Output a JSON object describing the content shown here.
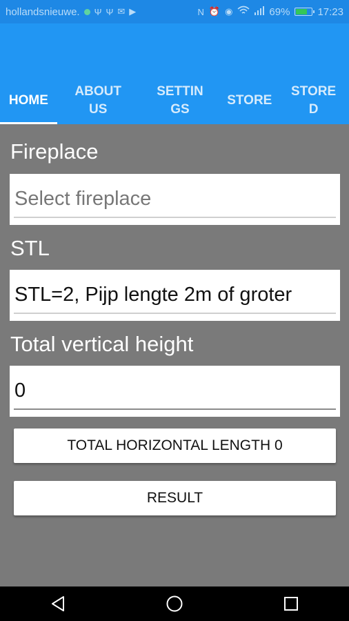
{
  "status_bar": {
    "notification_text": "hollandsnieuwe.",
    "battery_percent": "69%",
    "battery_level": 0.69,
    "time": "17:23",
    "icons": [
      "whatsapp-dot-icon",
      "usb-icon",
      "usb-icon",
      "mail-icon",
      "play-store-icon",
      "nfc-icon",
      "alarm-icon",
      "eye-icon",
      "wifi-icon",
      "signal-icon",
      "battery-icon"
    ]
  },
  "tabs": [
    {
      "label": "HOME",
      "active": true
    },
    {
      "label": "ABOUTUS",
      "active": false
    },
    {
      "label": "SETTINGS",
      "active": false
    },
    {
      "label": "STORE",
      "active": false
    },
    {
      "label": "STORED",
      "active": false
    }
  ],
  "form": {
    "fireplace_label": "Fireplace",
    "fireplace_placeholder": "Select fireplace",
    "stl_label": "STL",
    "stl_value": "STL=2,   Pijp lengte 2m of groter",
    "height_label": "Total vertical height",
    "height_value": "0"
  },
  "buttons": {
    "horizontal_length": "TOTAL HORIZONTAL LENGTH 0",
    "result": "RESULT"
  },
  "colors": {
    "primary": "#2196f3",
    "background": "#7a7a7a",
    "nav_bar": "#000000"
  }
}
